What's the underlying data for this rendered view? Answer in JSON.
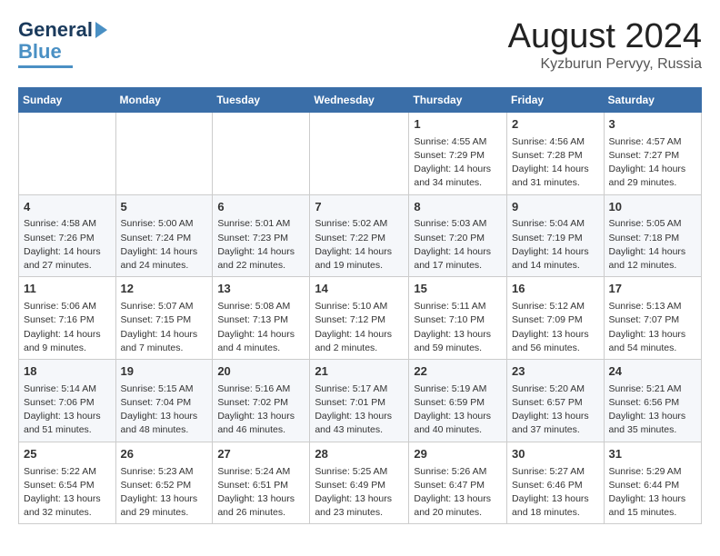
{
  "header": {
    "logo_line1": "General",
    "logo_line2": "Blue",
    "month": "August 2024",
    "location": "Kyzburun Pervyy, Russia"
  },
  "weekdays": [
    "Sunday",
    "Monday",
    "Tuesday",
    "Wednesday",
    "Thursday",
    "Friday",
    "Saturday"
  ],
  "weeks": [
    [
      {
        "day": "",
        "content": ""
      },
      {
        "day": "",
        "content": ""
      },
      {
        "day": "",
        "content": ""
      },
      {
        "day": "",
        "content": ""
      },
      {
        "day": "1",
        "content": "Sunrise: 4:55 AM\nSunset: 7:29 PM\nDaylight: 14 hours\nand 34 minutes."
      },
      {
        "day": "2",
        "content": "Sunrise: 4:56 AM\nSunset: 7:28 PM\nDaylight: 14 hours\nand 31 minutes."
      },
      {
        "day": "3",
        "content": "Sunrise: 4:57 AM\nSunset: 7:27 PM\nDaylight: 14 hours\nand 29 minutes."
      }
    ],
    [
      {
        "day": "4",
        "content": "Sunrise: 4:58 AM\nSunset: 7:26 PM\nDaylight: 14 hours\nand 27 minutes."
      },
      {
        "day": "5",
        "content": "Sunrise: 5:00 AM\nSunset: 7:24 PM\nDaylight: 14 hours\nand 24 minutes."
      },
      {
        "day": "6",
        "content": "Sunrise: 5:01 AM\nSunset: 7:23 PM\nDaylight: 14 hours\nand 22 minutes."
      },
      {
        "day": "7",
        "content": "Sunrise: 5:02 AM\nSunset: 7:22 PM\nDaylight: 14 hours\nand 19 minutes."
      },
      {
        "day": "8",
        "content": "Sunrise: 5:03 AM\nSunset: 7:20 PM\nDaylight: 14 hours\nand 17 minutes."
      },
      {
        "day": "9",
        "content": "Sunrise: 5:04 AM\nSunset: 7:19 PM\nDaylight: 14 hours\nand 14 minutes."
      },
      {
        "day": "10",
        "content": "Sunrise: 5:05 AM\nSunset: 7:18 PM\nDaylight: 14 hours\nand 12 minutes."
      }
    ],
    [
      {
        "day": "11",
        "content": "Sunrise: 5:06 AM\nSunset: 7:16 PM\nDaylight: 14 hours\nand 9 minutes."
      },
      {
        "day": "12",
        "content": "Sunrise: 5:07 AM\nSunset: 7:15 PM\nDaylight: 14 hours\nand 7 minutes."
      },
      {
        "day": "13",
        "content": "Sunrise: 5:08 AM\nSunset: 7:13 PM\nDaylight: 14 hours\nand 4 minutes."
      },
      {
        "day": "14",
        "content": "Sunrise: 5:10 AM\nSunset: 7:12 PM\nDaylight: 14 hours\nand 2 minutes."
      },
      {
        "day": "15",
        "content": "Sunrise: 5:11 AM\nSunset: 7:10 PM\nDaylight: 13 hours\nand 59 minutes."
      },
      {
        "day": "16",
        "content": "Sunrise: 5:12 AM\nSunset: 7:09 PM\nDaylight: 13 hours\nand 56 minutes."
      },
      {
        "day": "17",
        "content": "Sunrise: 5:13 AM\nSunset: 7:07 PM\nDaylight: 13 hours\nand 54 minutes."
      }
    ],
    [
      {
        "day": "18",
        "content": "Sunrise: 5:14 AM\nSunset: 7:06 PM\nDaylight: 13 hours\nand 51 minutes."
      },
      {
        "day": "19",
        "content": "Sunrise: 5:15 AM\nSunset: 7:04 PM\nDaylight: 13 hours\nand 48 minutes."
      },
      {
        "day": "20",
        "content": "Sunrise: 5:16 AM\nSunset: 7:02 PM\nDaylight: 13 hours\nand 46 minutes."
      },
      {
        "day": "21",
        "content": "Sunrise: 5:17 AM\nSunset: 7:01 PM\nDaylight: 13 hours\nand 43 minutes."
      },
      {
        "day": "22",
        "content": "Sunrise: 5:19 AM\nSunset: 6:59 PM\nDaylight: 13 hours\nand 40 minutes."
      },
      {
        "day": "23",
        "content": "Sunrise: 5:20 AM\nSunset: 6:57 PM\nDaylight: 13 hours\nand 37 minutes."
      },
      {
        "day": "24",
        "content": "Sunrise: 5:21 AM\nSunset: 6:56 PM\nDaylight: 13 hours\nand 35 minutes."
      }
    ],
    [
      {
        "day": "25",
        "content": "Sunrise: 5:22 AM\nSunset: 6:54 PM\nDaylight: 13 hours\nand 32 minutes."
      },
      {
        "day": "26",
        "content": "Sunrise: 5:23 AM\nSunset: 6:52 PM\nDaylight: 13 hours\nand 29 minutes."
      },
      {
        "day": "27",
        "content": "Sunrise: 5:24 AM\nSunset: 6:51 PM\nDaylight: 13 hours\nand 26 minutes."
      },
      {
        "day": "28",
        "content": "Sunrise: 5:25 AM\nSunset: 6:49 PM\nDaylight: 13 hours\nand 23 minutes."
      },
      {
        "day": "29",
        "content": "Sunrise: 5:26 AM\nSunset: 6:47 PM\nDaylight: 13 hours\nand 20 minutes."
      },
      {
        "day": "30",
        "content": "Sunrise: 5:27 AM\nSunset: 6:46 PM\nDaylight: 13 hours\nand 18 minutes."
      },
      {
        "day": "31",
        "content": "Sunrise: 5:29 AM\nSunset: 6:44 PM\nDaylight: 13 hours\nand 15 minutes."
      }
    ]
  ]
}
